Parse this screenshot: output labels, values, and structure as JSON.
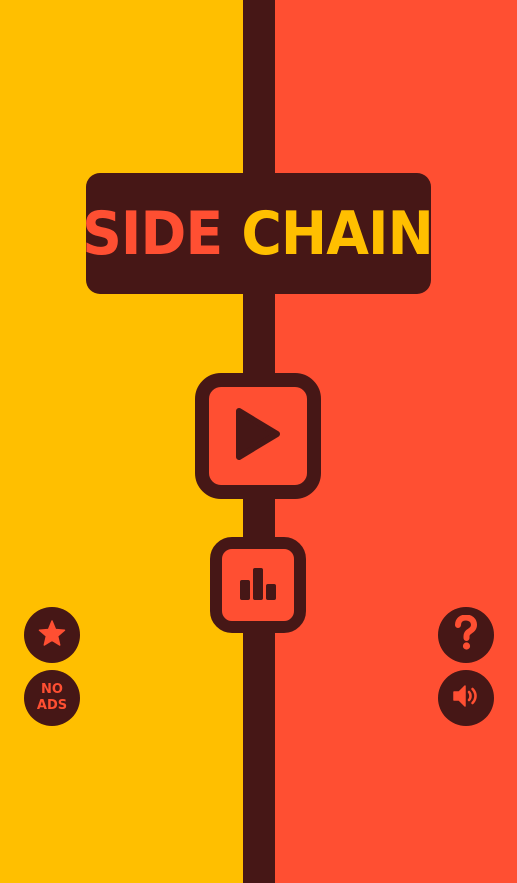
{
  "title": {
    "part1": "SIDE",
    "part2": "CHAIN"
  },
  "buttons": {
    "play": {
      "icon": "play-icon"
    },
    "leaderboard": {
      "icon": "leaderboard-icon"
    },
    "rate": {
      "icon": "star-icon"
    },
    "no_ads": {
      "label": "NO ADS"
    },
    "help": {
      "icon": "question-icon"
    },
    "sound": {
      "icon": "speaker-icon"
    }
  },
  "colors": {
    "yellow": "#FFBF00",
    "red": "#FF4F32",
    "dark": "#461716"
  }
}
